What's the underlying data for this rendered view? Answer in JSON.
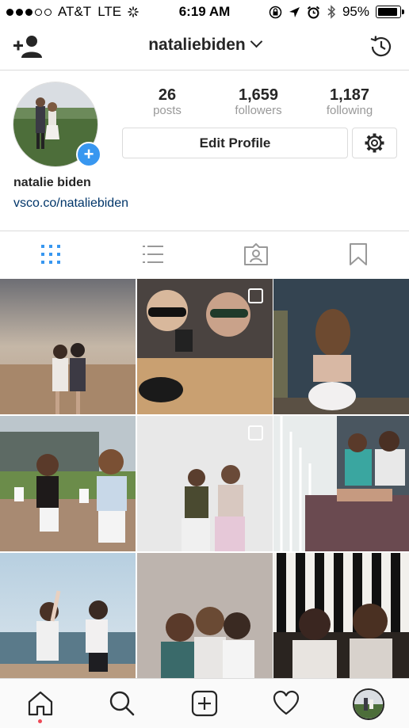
{
  "status_bar": {
    "carrier": "AT&T",
    "network": "LTE",
    "time": "6:19 AM",
    "battery": "95%"
  },
  "header": {
    "username": "nataliebiden"
  },
  "profile": {
    "stats": [
      {
        "value": "26",
        "label": "posts"
      },
      {
        "value": "1,659",
        "label": "followers"
      },
      {
        "value": "1,187",
        "label": "following"
      }
    ],
    "edit_label": "Edit Profile",
    "name": "natalie biden",
    "website": "vsco.co/nataliebiden"
  },
  "tabs": [
    "grid-icon",
    "list-icon",
    "tagged-icon",
    "saved-icon"
  ],
  "active_tab": "grid-icon",
  "bottom_nav": [
    "home-icon",
    "search-icon",
    "add-post-icon",
    "heart-icon",
    "profile-avatar"
  ],
  "colors": {
    "accent": "#3897f0",
    "link": "#003569",
    "notification": "#ed4956"
  }
}
